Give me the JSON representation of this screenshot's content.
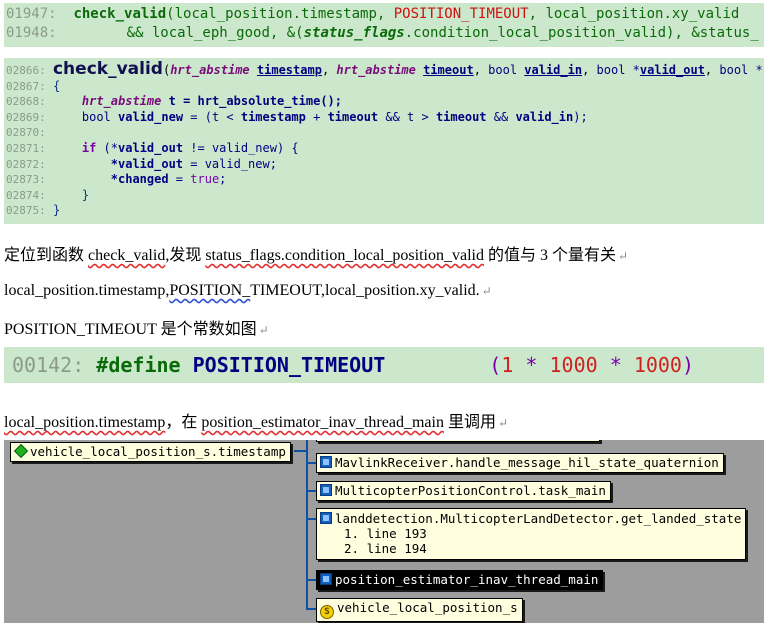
{
  "code1": {
    "lines": [
      {
        "num": "01947:",
        "fn": "check_valid",
        "p1": "(local_position.timestamp, ",
        "red": "POSITION_TIMEOUT",
        "p2": ", local_position.xy_valid"
      },
      {
        "num": "01948:",
        "txt": "&& local_eph_good, &(",
        "it": "status_flags",
        "txt2": ".condition_local_position_valid), &status_"
      }
    ]
  },
  "code2": {
    "sig": {
      "num": "02866:",
      "fn": "check_valid",
      "t1": "hrt_abstime",
      "p1": "timestamp",
      "t2": "hrt_abstime",
      "p2": "timeout",
      "p3": "bool",
      "p4": "valid_in",
      "p5": "bool *",
      "p6": "valid_out",
      "p7": "bool *ch"
    },
    "nums": [
      "02867:",
      "02868:",
      "02869:",
      "02870:",
      "02871:",
      "02872:",
      "02873:",
      "02874:",
      "02875:"
    ],
    "l2": {
      "t": "hrt_abstime",
      "v": "t",
      "call": "= hrt_absolute_time();"
    },
    "l3": {
      "b": "bool",
      "v": "valid_new",
      "e1": "= (t < ",
      "ts": "timestamp",
      "e2": " + ",
      "to": "timeout",
      "e3": " && t > ",
      "to2": "timeout",
      "e4": " && ",
      "vi": "valid_in",
      "e5": ");"
    },
    "l5": {
      "if": "if",
      "e1": " (*",
      "vo": "valid_out",
      "e2": " != valid_new) {"
    },
    "l6": {
      "vo": "*valid_out",
      "e": " = valid_new;"
    },
    "l7": {
      "ch": "*changed",
      "e": " = ",
      "tr": "true",
      "e2": ";"
    },
    "braces": [
      "{",
      "}",
      "}"
    ]
  },
  "para1": {
    "a": "定位到函数 ",
    "b": "check_valid",
    "c": ",发现 ",
    "d": "status_flags.condition_local_position_valid",
    "e": " 的值与 3 个量有关"
  },
  "para2": {
    "a": "local_position.timestamp,",
    "b": "POSITION_",
    "c": "TIMEOUT,local_position.xy_valid."
  },
  "para3": "POSITION_TIMEOUT 是个常数如图",
  "code3": {
    "num": "00142:",
    "def": "#define",
    "name": "POSITION_TIMEOUT",
    "o": "(",
    "n1": "1",
    "m1": " * ",
    "n2": "1000",
    "m2": " * ",
    "n3": "1000",
    "c": ")"
  },
  "para4": {
    "a": "local_position.timestamp",
    "b": "，在 ",
    "c": "position_estimator_inav_thread_main",
    "d": " 里调用"
  },
  "graph": {
    "root": "vehicle_local_position_s.timestamp",
    "nodes": [
      "MavlinkReceiver.handle_message_hil_state_quaternion",
      "MulticopterPositionControl.task_main",
      "landdetection.MulticopterLandDetector.get_landed_state",
      "position_estimator_inav_thread_main",
      "vehicle_local_position_s"
    ],
    "lines_sub": [
      "1.  line 193",
      "2.  line 194"
    ],
    "colors": {
      "bg": "#9d9d9d",
      "node": "#ffffe0",
      "selected": "#000000",
      "connector": "#1050a0"
    }
  }
}
